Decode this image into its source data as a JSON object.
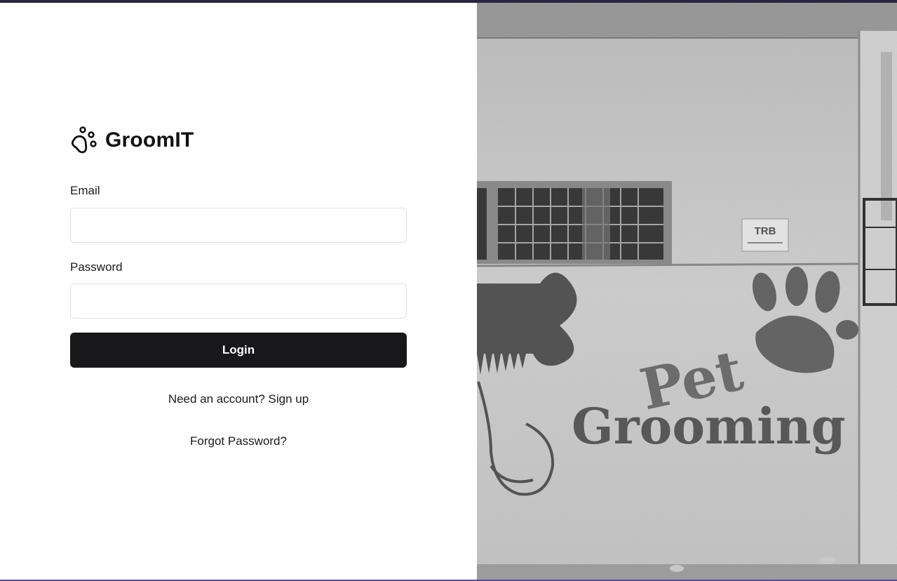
{
  "brand": {
    "name": "GroomIT",
    "icon": "paw-icon"
  },
  "form": {
    "email_label": "Email",
    "email_value": "",
    "password_label": "Password",
    "password_value": "",
    "login_label": "Login"
  },
  "links": {
    "signup": "Need an account? Sign up",
    "forgot": "Forgot Password?"
  },
  "hero": {
    "mural_line1": "Pet",
    "mural_line2": "Grooming",
    "sign_text": "TRB"
  }
}
